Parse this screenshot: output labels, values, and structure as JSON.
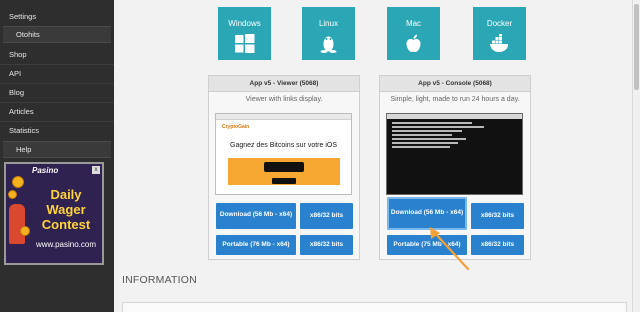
{
  "sidebar": {
    "items": [
      {
        "label": "Settings"
      },
      {
        "label": "Otohits",
        "sub": true
      },
      {
        "label": "Shop"
      },
      {
        "label": "API"
      },
      {
        "label": "Blog"
      },
      {
        "label": "Articles"
      },
      {
        "label": "Statistics"
      },
      {
        "label": "Help",
        "sub": true
      }
    ]
  },
  "ad": {
    "brand": "Pasino",
    "line1": "Daily",
    "line2": "Wager",
    "line3": "Contest",
    "url": "www.pasino.com",
    "close": "x"
  },
  "os_tiles": [
    {
      "label": "Windows",
      "icon": "windows-icon"
    },
    {
      "label": "Linux",
      "icon": "linux-icon"
    },
    {
      "label": "Mac",
      "icon": "apple-icon"
    },
    {
      "label": "Docker",
      "icon": "docker-icon"
    }
  ],
  "viewer": {
    "title": "App v5 - Viewer (5068)",
    "desc": "Viewer with links display.",
    "screenshot_title": "Gagnez des Bitcoins sur votre iOS",
    "screenshot_logo": "CryptoGain",
    "download_label": "Download (56 Mb - x64)",
    "x86_label": "x86/32 bits",
    "portable_label": "Portable (76 Mb - x64)",
    "portable_x86_label": "x86/32 bits"
  },
  "console": {
    "title": "App v5 - Console (5068)",
    "desc": "Simple, light, made to run 24 hours a day.",
    "download_label": "Download (56 Mb - x64)",
    "x86_label": "x86/32 bits",
    "portable_label": "Portable (75 Mb - x64)",
    "portable_x86_label": "x86/32 bits"
  },
  "section_heading": "INFORMATION",
  "colors": {
    "tile": "#2ba6b5",
    "button": "#2a81ce",
    "highlight": "#78b9ee",
    "arrow": "#f3a23a",
    "sidebar": "#2e2e2e"
  }
}
